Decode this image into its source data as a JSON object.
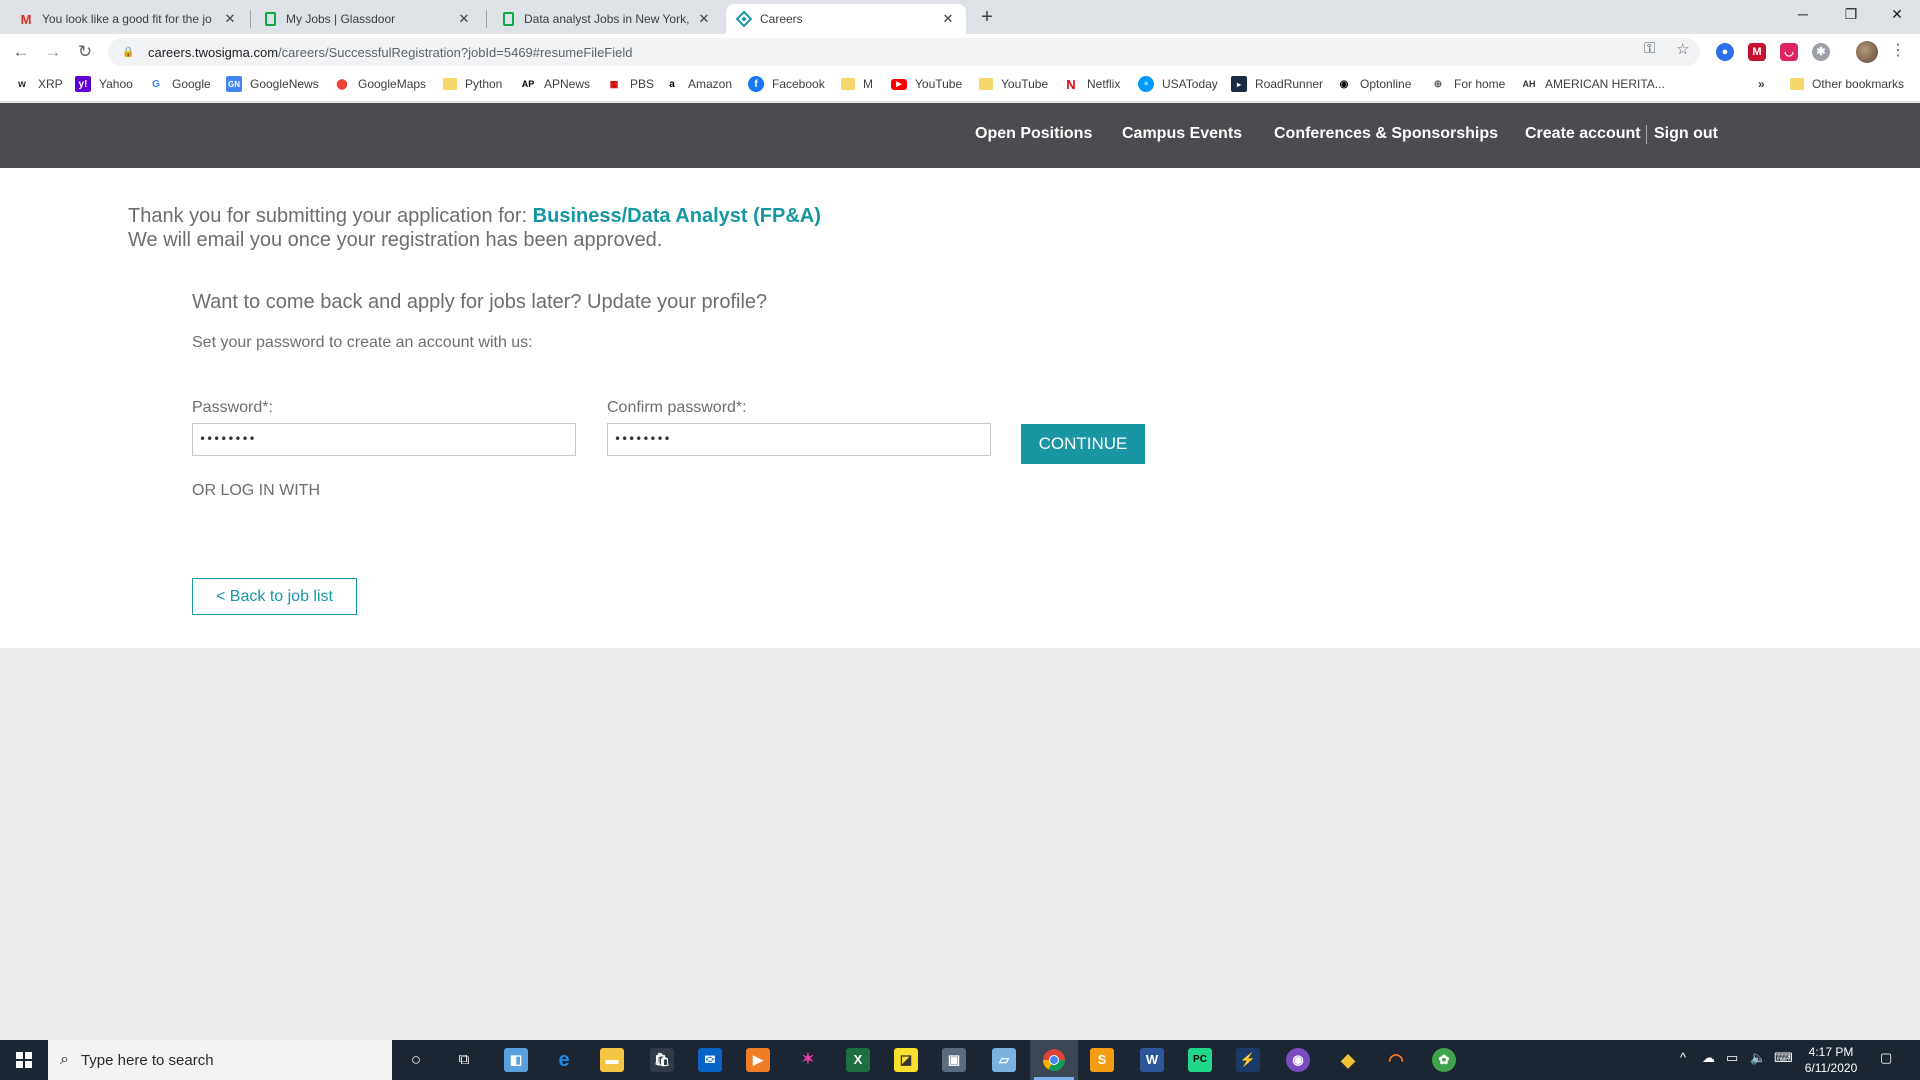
{
  "browser": {
    "tabs": [
      {
        "title": "You look like a good fit for the jo",
        "favicon": "gmail-icon",
        "active": false
      },
      {
        "title": "My Jobs | Glassdoor",
        "favicon": "glassdoor-icon",
        "active": false
      },
      {
        "title": "Data analyst Jobs in New York, N",
        "favicon": "glassdoor-icon",
        "active": false
      },
      {
        "title": "Careers",
        "favicon": "twosigma-icon",
        "active": true
      }
    ],
    "new_tab": "+",
    "url_host": "careers.twosigma.com",
    "url_path": "/careers/SuccessfulRegistration?jobId=5469#resumeFileField",
    "bookmarks": [
      {
        "label": "XRP"
      },
      {
        "label": "Yahoo"
      },
      {
        "label": "Google"
      },
      {
        "label": "GoogleNews"
      },
      {
        "label": "GoogleMaps"
      },
      {
        "label": "Python"
      },
      {
        "label": "APNews"
      },
      {
        "label": "PBS"
      },
      {
        "label": "Amazon"
      },
      {
        "label": "Facebook"
      },
      {
        "label": "M"
      },
      {
        "label": "YouTube"
      },
      {
        "label": "YouTube"
      },
      {
        "label": "Netflix"
      },
      {
        "label": "USAToday"
      },
      {
        "label": "RoadRunner"
      },
      {
        "label": "Optonline"
      },
      {
        "label": "For home"
      },
      {
        "label": "AMERICAN HERITA..."
      }
    ],
    "overflow": "»",
    "other_bookmarks": "Other bookmarks"
  },
  "site": {
    "nav": {
      "open_positions": "Open Positions",
      "campus_events": "Campus Events",
      "conferences": "Conferences & Sponsorships",
      "create_account": "Create account",
      "sign_out": "Sign out"
    },
    "thanks_prefix": "Thank you for submitting your application for: ",
    "job_title": "Business/Data Analyst (FP&A)",
    "email_note": "We will email you once your registration has been approved.",
    "later_question": "Want to come back and apply for jobs later? Update your profile?",
    "set_password": "Set your password to create an account with us:",
    "password_label": "Password*:",
    "password_value": "••••••••",
    "confirm_label": "Confirm password*:",
    "confirm_value": "••••••••",
    "continue_button": "CONTINUE",
    "or_login": "OR LOG IN WITH",
    "back_button": "< Back to job list",
    "colors": {
      "accent": "#1a95a3",
      "header": "#4a4c50",
      "text": "#6d6e71"
    }
  },
  "taskbar": {
    "search_placeholder": "Type here to search",
    "time": "4:17 PM",
    "date": "6/11/2020"
  }
}
